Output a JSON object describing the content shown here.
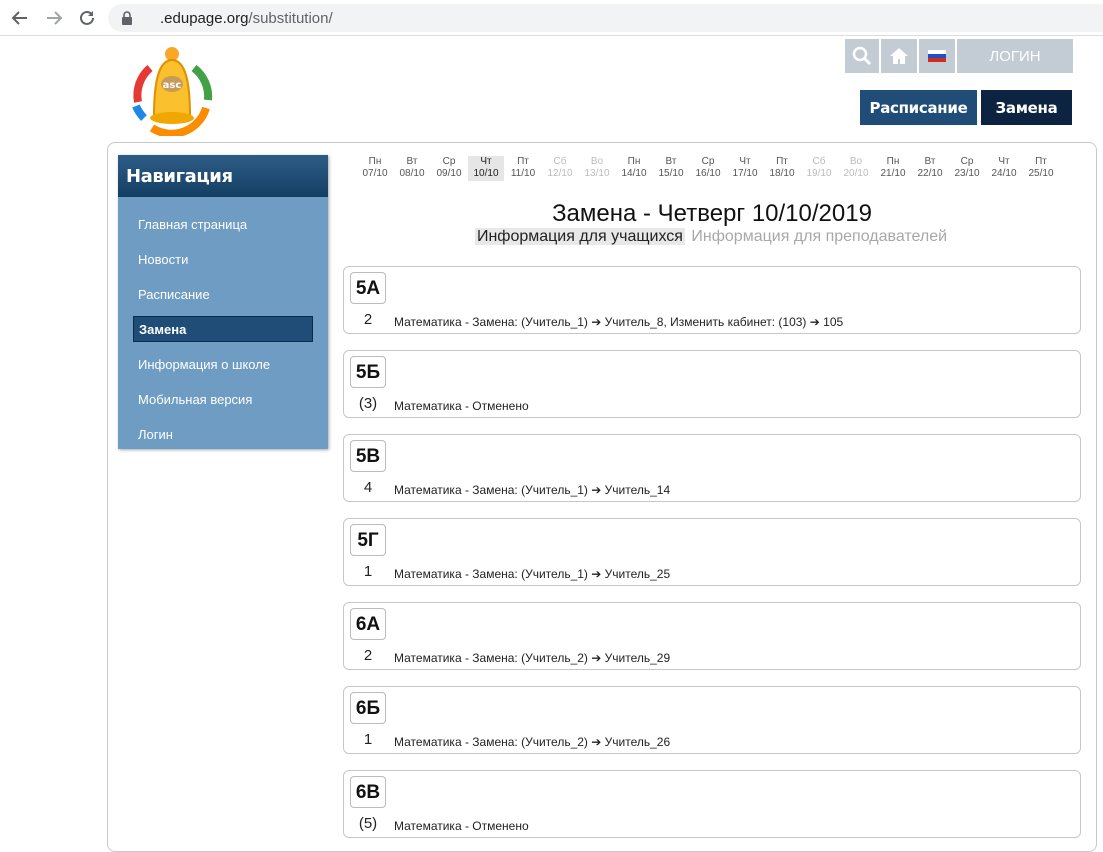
{
  "browser": {
    "url_host": ".edupage.org",
    "url_path": "/substitution/"
  },
  "header": {
    "login_label": "ЛОГИН",
    "tab_schedule": "Расписание",
    "tab_substitution": "Замена",
    "colors": {
      "tab_schedule_bg": "#1f4d78",
      "tab_substitution_bg": "#0c2342",
      "icon_bg": "#c3ccd5"
    }
  },
  "navigation": {
    "title": "Навигация",
    "items": [
      {
        "label": "Главная страница",
        "active": false
      },
      {
        "label": "Новости",
        "active": false
      },
      {
        "label": "Расписание",
        "active": false
      },
      {
        "label": "Замена",
        "active": true
      },
      {
        "label": "Информация о школе",
        "active": false
      },
      {
        "label": "Мобильная версия",
        "active": false
      },
      {
        "label": "Логин",
        "active": false
      }
    ]
  },
  "days": [
    {
      "dow": "Пн",
      "date": "07/10",
      "state": "normal"
    },
    {
      "dow": "Вт",
      "date": "08/10",
      "state": "normal"
    },
    {
      "dow": "Ср",
      "date": "09/10",
      "state": "normal"
    },
    {
      "dow": "Чт",
      "date": "10/10",
      "state": "active"
    },
    {
      "dow": "Пт",
      "date": "11/10",
      "state": "normal"
    },
    {
      "dow": "Сб",
      "date": "12/10",
      "state": "weekend"
    },
    {
      "dow": "Во",
      "date": "13/10",
      "state": "weekend"
    },
    {
      "dow": "Пн",
      "date": "14/10",
      "state": "normal"
    },
    {
      "dow": "Вт",
      "date": "15/10",
      "state": "normal"
    },
    {
      "dow": "Ср",
      "date": "16/10",
      "state": "normal"
    },
    {
      "dow": "Чт",
      "date": "17/10",
      "state": "normal"
    },
    {
      "dow": "Пт",
      "date": "18/10",
      "state": "normal"
    },
    {
      "dow": "Сб",
      "date": "19/10",
      "state": "weekend"
    },
    {
      "dow": "Во",
      "date": "20/10",
      "state": "weekend"
    },
    {
      "dow": "Пн",
      "date": "21/10",
      "state": "normal"
    },
    {
      "dow": "Вт",
      "date": "22/10",
      "state": "normal"
    },
    {
      "dow": "Ср",
      "date": "23/10",
      "state": "normal"
    },
    {
      "dow": "Чт",
      "date": "24/10",
      "state": "normal"
    },
    {
      "dow": "Пт",
      "date": "25/10",
      "state": "normal"
    }
  ],
  "main": {
    "title": "Замена - Четверг 10/10/2019",
    "tab_students": "Информация для учащихся",
    "tab_teachers": "Информация для преподавателей"
  },
  "substitutions": [
    {
      "class": "5А",
      "period": "2",
      "text": "Математика - Замена: (Учитель_1) ➔ Учитель_8, Изменить кабинет: (103) ➔ 105"
    },
    {
      "class": "5Б",
      "period": "(3)",
      "text": "Математика - Отменено"
    },
    {
      "class": "5В",
      "period": "4",
      "text": "Математика - Замена: (Учитель_1) ➔ Учитель_14"
    },
    {
      "class": "5Г",
      "period": "1",
      "text": "Математика - Замена: (Учитель_1) ➔ Учитель_25"
    },
    {
      "class": "6А",
      "period": "2",
      "text": "Математика - Замена: (Учитель_2) ➔ Учитель_29"
    },
    {
      "class": "6Б",
      "period": "1",
      "text": "Математика - Замена: (Учитель_2) ➔ Учитель_26"
    },
    {
      "class": "6В",
      "period": "(5)",
      "text": "Математика - Отменено"
    }
  ]
}
